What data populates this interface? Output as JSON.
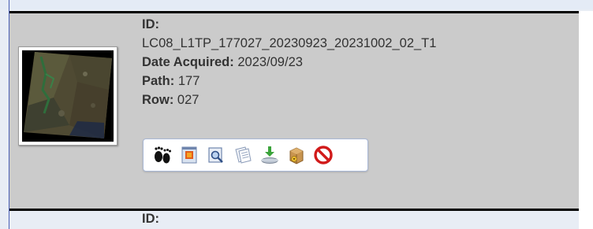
{
  "results": [
    {
      "id_label": "ID:",
      "id_value": "LC08_L1TP_177027_20230923_20231002_02_T1",
      "date_label": "Date Acquired:",
      "date_value": "2023/09/23",
      "path_label": "Path:",
      "path_value": "177",
      "row_label": "Row:",
      "row_value": "027",
      "tools": [
        {
          "icon": "footprint-icon"
        },
        {
          "icon": "metadata-overlay-icon"
        },
        {
          "icon": "browse-preview-icon"
        },
        {
          "icon": "metadata-icon"
        },
        {
          "icon": "download-icon"
        },
        {
          "icon": "bulk-download-icon"
        },
        {
          "icon": "exclude-icon"
        }
      ]
    }
  ],
  "next_result": {
    "id_label": "ID:"
  },
  "colors": {
    "row_background": "#cbcbcb",
    "row_separator": "#000000",
    "text": "#333333",
    "exclude_red": "#d11a1a"
  }
}
